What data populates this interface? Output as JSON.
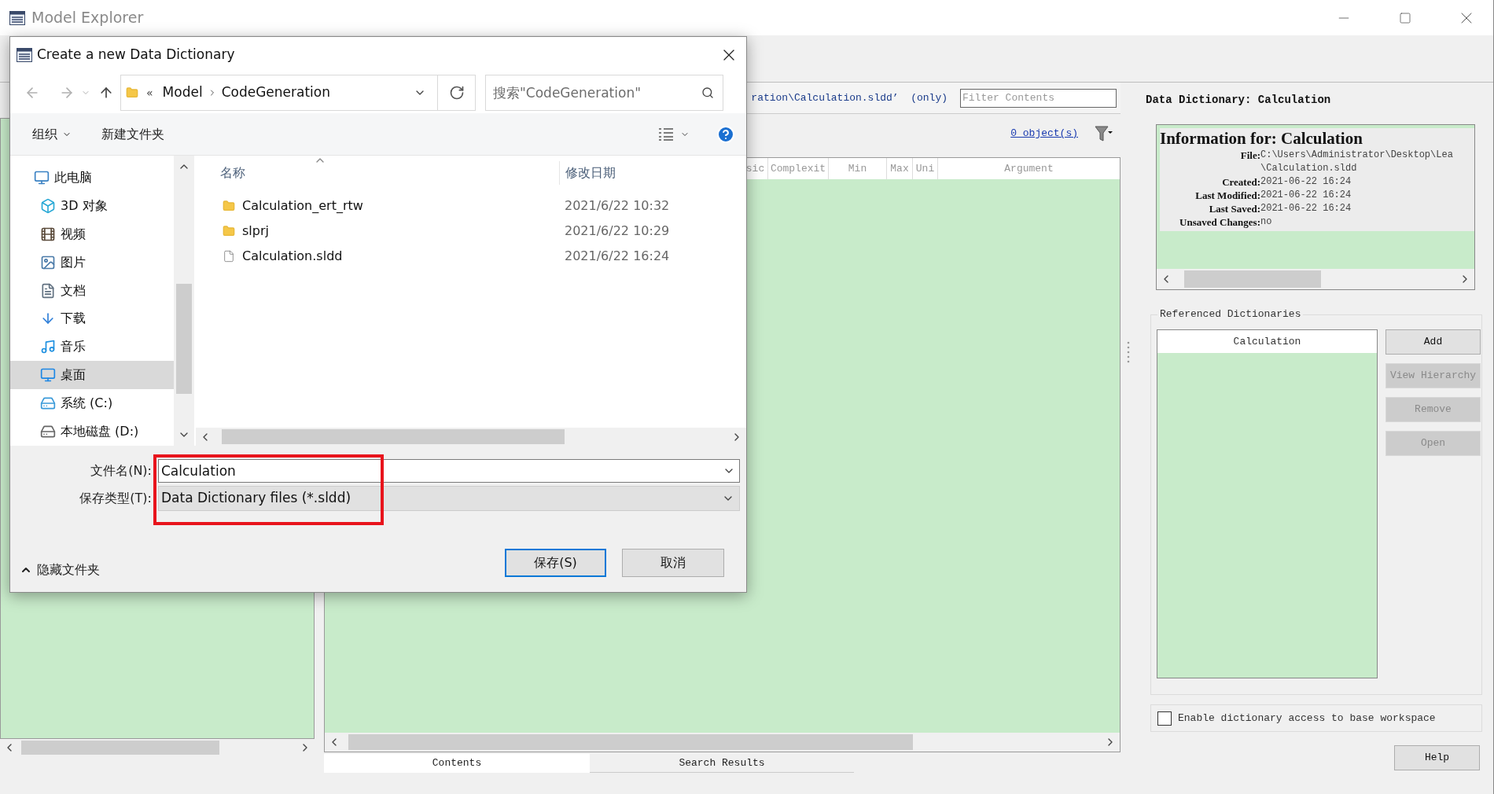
{
  "window": {
    "title": "Model Explorer"
  },
  "path_bar": {
    "text": "ration\\Calculation.sldd’  (only)",
    "filter_placeholder": "Filter Contents"
  },
  "object_count": "0 object(s)",
  "table": {
    "columns": [
      "sic",
      "Complexit",
      "Min",
      "Max",
      "Uni",
      "Argument"
    ]
  },
  "tabs": [
    {
      "label": "Contents",
      "selected": true
    },
    {
      "label": "Search Results",
      "selected": false
    }
  ],
  "details": {
    "heading": "Data Dictionary: Calculation",
    "info_title": "Information for: Calculation",
    "fields": [
      {
        "label": "File:",
        "values": [
          "C:\\Users\\Administrator\\Desktop\\Lea",
          "\\Calculation.sldd"
        ]
      },
      {
        "label": "Created:",
        "values": [
          "2021-06-22 16:24"
        ]
      },
      {
        "label": "Last Modified:",
        "values": [
          "2021-06-22 16:24"
        ]
      },
      {
        "label": "Last Saved:",
        "values": [
          "2021-06-22 16:24"
        ]
      },
      {
        "label": "Unsaved Changes:",
        "values": [
          "no"
        ]
      }
    ]
  },
  "referenced": {
    "title": "Referenced Dictionaries",
    "column": "Calculation",
    "buttons": [
      {
        "label": "Add",
        "disabled": false
      },
      {
        "label": "View Hierarchy",
        "disabled": true
      },
      {
        "label": "Remove",
        "disabled": true
      },
      {
        "label": "Open",
        "disabled": true
      }
    ]
  },
  "base_workspace": {
    "label": "Enable dictionary access to base workspace",
    "checked": false
  },
  "help": "Help",
  "dialog": {
    "title": "Create a new Data Dictionary",
    "breadcrumb_overflow": "«",
    "breadcrumb": [
      "Model",
      "CodeGeneration"
    ],
    "search_placeholder": "搜索\"CodeGeneration\"",
    "organize": "组织",
    "new_folder": "新建文件夹",
    "nav": [
      {
        "label": "此电脑",
        "kind": "computer",
        "selected": false,
        "children": [
          {
            "label": "3D 对象",
            "kind": "cube",
            "selected": false
          },
          {
            "label": "视频",
            "kind": "video",
            "selected": false
          },
          {
            "label": "图片",
            "kind": "pictures",
            "selected": false
          },
          {
            "label": "文档",
            "kind": "documents",
            "selected": false
          },
          {
            "label": "下载",
            "kind": "downloads",
            "selected": false
          },
          {
            "label": "音乐",
            "kind": "music",
            "selected": false
          },
          {
            "label": "桌面",
            "kind": "desktop",
            "selected": true
          },
          {
            "label": "系统 (C:)",
            "kind": "system-drive",
            "selected": false
          },
          {
            "label": "本地磁盘 (D:)",
            "kind": "drive",
            "selected": false
          }
        ]
      }
    ],
    "columns": [
      "名称",
      "修改日期"
    ],
    "files": [
      {
        "name": "Calculation_ert_rtw",
        "modified": "2021/6/22 10:32",
        "kind": "folder"
      },
      {
        "name": "slprj",
        "modified": "2021/6/22 10:29",
        "kind": "folder"
      },
      {
        "name": "Calculation.sldd",
        "modified": "2021/6/22 16:24",
        "kind": "file"
      }
    ],
    "filename_label": "文件名(N):",
    "filename": "Calculation",
    "type_label": "保存类型(T):",
    "type": "Data Dictionary files (*.sldd)",
    "hide_folders": "隐藏文件夹",
    "save": "保存(S)",
    "cancel": "取消"
  }
}
